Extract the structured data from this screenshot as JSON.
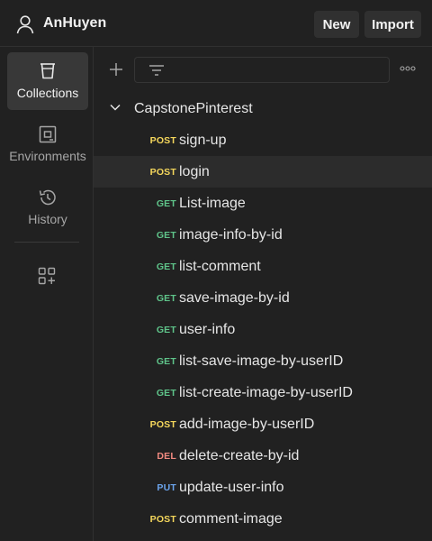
{
  "header": {
    "workspace_name": "AnHuyen",
    "new_label": "New",
    "import_label": "Import"
  },
  "sidebar": {
    "items": [
      {
        "label": "Collections",
        "icon": "trash-bin-icon",
        "active": true
      },
      {
        "label": "Environments",
        "icon": "environment-icon",
        "active": false
      },
      {
        "label": "History",
        "icon": "history-icon",
        "active": false
      }
    ],
    "configure_icon": "configure-workbench-icon"
  },
  "toolbar": {
    "add_icon": "plus-icon",
    "filter_icon": "filter-icon",
    "more_icon": "more-horizontal-icon"
  },
  "collection": {
    "name": "CapstonePinterest",
    "expanded": true,
    "requests": [
      {
        "method": "POST",
        "name": "sign-up"
      },
      {
        "method": "POST",
        "name": "login",
        "selected": true
      },
      {
        "method": "GET",
        "name": "List-image"
      },
      {
        "method": "GET",
        "name": "image-info-by-id"
      },
      {
        "method": "GET",
        "name": "list-comment"
      },
      {
        "method": "GET",
        "name": "save-image-by-id"
      },
      {
        "method": "GET",
        "name": "user-info"
      },
      {
        "method": "GET",
        "name": "list-save-image-by-userID"
      },
      {
        "method": "GET",
        "name": "list-create-image-by-userID"
      },
      {
        "method": "POST",
        "name": "add-image-by-userID"
      },
      {
        "method": "DEL",
        "name": "delete-create-by-id"
      },
      {
        "method": "PUT",
        "name": "update-user-info"
      },
      {
        "method": "POST",
        "name": "comment-image"
      }
    ]
  },
  "colors": {
    "POST": "#f5d75c",
    "GET": "#5fc48a",
    "DEL": "#f08a80",
    "PUT": "#6ba4ec"
  }
}
